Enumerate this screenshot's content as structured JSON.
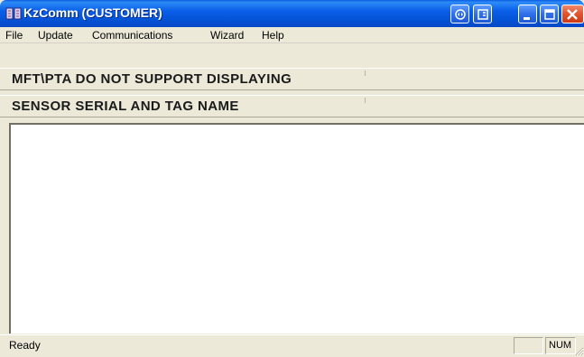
{
  "window": {
    "title": "KzComm (CUSTOMER)",
    "app_icon": "kzcomm-app-icon",
    "title_buttons": [
      "restore-alt-icon",
      "page-icon",
      "minimize-icon",
      "maximize-icon",
      "close-icon"
    ]
  },
  "menu": {
    "items": [
      "File",
      "Update",
      "Communications",
      "Wizard",
      "Help"
    ]
  },
  "headers": {
    "line1": "MFT\\PTA DO NOT SUPPORT DISPLAYING",
    "line2": "SENSOR SERIAL AND TAG NAME"
  },
  "status": {
    "text": "Ready",
    "empty_pane": "",
    "num_indicator": "NUM"
  },
  "colors": {
    "titlebar": "#0554d8",
    "close_button": "#e2532e",
    "chrome": "#ece9d8"
  }
}
